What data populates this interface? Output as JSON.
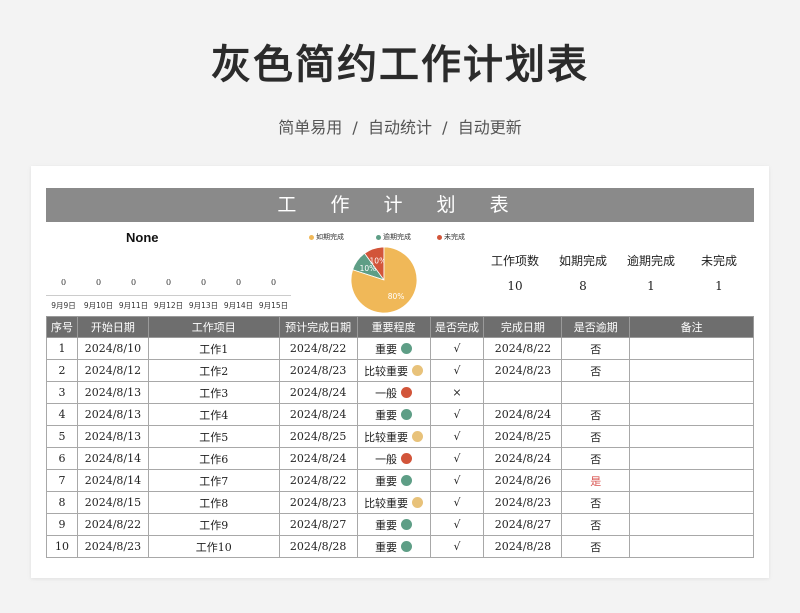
{
  "banner": {
    "title": "灰色简约工作计划表",
    "subtitle": "简单易用  /  自动统计  /  自动更新"
  },
  "sheet_title": "工 作 计 划 表",
  "mini_chart": {
    "title": "None",
    "values": [
      "0",
      "0",
      "0",
      "0",
      "0",
      "0",
      "0"
    ],
    "dates": [
      "9月9日",
      "9月10日",
      "9月11日",
      "9月12日",
      "9月13日",
      "9月14日",
      "9月15日"
    ]
  },
  "chart_data": {
    "type": "pie",
    "legend": [
      "如期完成",
      "逾期完成",
      "未完成"
    ],
    "values": [
      80,
      10,
      10
    ],
    "labels": [
      "80%",
      "10%",
      "10%"
    ],
    "colors": {
      "on_time": "#f0b858",
      "overdue": "#5e9e86",
      "unfinished": "#d2553a"
    }
  },
  "stats": {
    "headers": [
      "工作项数",
      "如期完成",
      "逾期完成",
      "未完成"
    ],
    "values": [
      "10",
      "8",
      "1",
      "1"
    ]
  },
  "table": {
    "headers": [
      "序号",
      "开始日期",
      "工作项目",
      "预计完成日期",
      "重要程度",
      "是否完成",
      "完成日期",
      "是否逾期",
      "备注"
    ],
    "rows": [
      {
        "no": "1",
        "start": "2024/8/10",
        "item": "工作1",
        "due": "2024/8/22",
        "imp": "重要",
        "done": "√",
        "finish": "2024/8/22",
        "overdue": "否",
        "note": ""
      },
      {
        "no": "2",
        "start": "2024/8/12",
        "item": "工作2",
        "due": "2024/8/23",
        "imp": "比较重要",
        "done": "√",
        "finish": "2024/8/23",
        "overdue": "否",
        "note": ""
      },
      {
        "no": "3",
        "start": "2024/8/13",
        "item": "工作3",
        "due": "2024/8/24",
        "imp": "一般",
        "done": "×",
        "finish": "",
        "overdue": "",
        "note": ""
      },
      {
        "no": "4",
        "start": "2024/8/13",
        "item": "工作4",
        "due": "2024/8/24",
        "imp": "重要",
        "done": "√",
        "finish": "2024/8/24",
        "overdue": "否",
        "note": ""
      },
      {
        "no": "5",
        "start": "2024/8/13",
        "item": "工作5",
        "due": "2024/8/25",
        "imp": "比较重要",
        "done": "√",
        "finish": "2024/8/25",
        "overdue": "否",
        "note": ""
      },
      {
        "no": "6",
        "start": "2024/8/14",
        "item": "工作6",
        "due": "2024/8/24",
        "imp": "一般",
        "done": "√",
        "finish": "2024/8/24",
        "overdue": "否",
        "note": ""
      },
      {
        "no": "7",
        "start": "2024/8/14",
        "item": "工作7",
        "due": "2024/8/22",
        "imp": "重要",
        "done": "√",
        "finish": "2024/8/26",
        "overdue": "是",
        "note": ""
      },
      {
        "no": "8",
        "start": "2024/8/15",
        "item": "工作8",
        "due": "2024/8/23",
        "imp": "比较重要",
        "done": "√",
        "finish": "2024/8/23",
        "overdue": "否",
        "note": ""
      },
      {
        "no": "9",
        "start": "2024/8/22",
        "item": "工作9",
        "due": "2024/8/27",
        "imp": "重要",
        "done": "√",
        "finish": "2024/8/27",
        "overdue": "否",
        "note": ""
      },
      {
        "no": "10",
        "start": "2024/8/23",
        "item": "工作10",
        "due": "2024/8/28",
        "imp": "重要",
        "done": "√",
        "finish": "2024/8/28",
        "overdue": "否",
        "note": ""
      }
    ],
    "importance_colors": {
      "重要": "#5e9e86",
      "比较重要": "#e8c27a",
      "一般": "#d2553a"
    }
  }
}
